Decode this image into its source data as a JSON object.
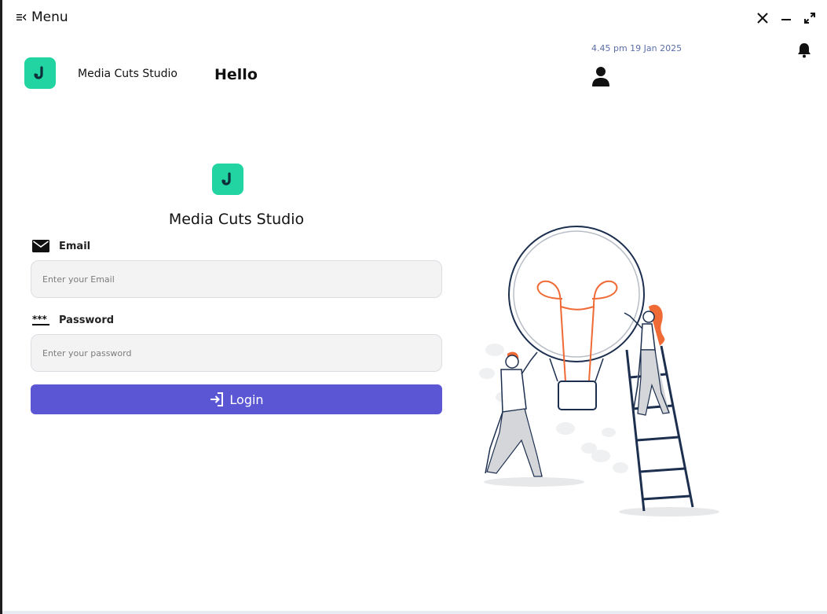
{
  "titlebar": {
    "menu_label": "Menu"
  },
  "header": {
    "brand_name": "Media Cuts Studio",
    "greeting": "Hello",
    "datetime": "4.45 pm 19 Jan 2025"
  },
  "login": {
    "brand_title": "Media Cuts Studio",
    "email_label": "Email",
    "email_placeholder": "Enter your Email",
    "email_value": "",
    "password_label": "Password",
    "password_placeholder": "Enter your password",
    "password_value": "",
    "login_label": "Login"
  },
  "colors": {
    "accent": "#5b57d4",
    "brand": "#21d4a2",
    "datetime": "#5b6fa8",
    "illustration_orange": "#f06a35",
    "illustration_navy": "#1d2f4f"
  },
  "icons": {
    "menu": "menu-collapse-icon",
    "close": "close-icon",
    "minimize": "minimize-icon",
    "maximize": "maximize-icon",
    "bell": "bell-icon",
    "user": "user-icon",
    "email": "mail-icon",
    "password": "password-dots-icon",
    "login": "login-arrow-icon"
  }
}
